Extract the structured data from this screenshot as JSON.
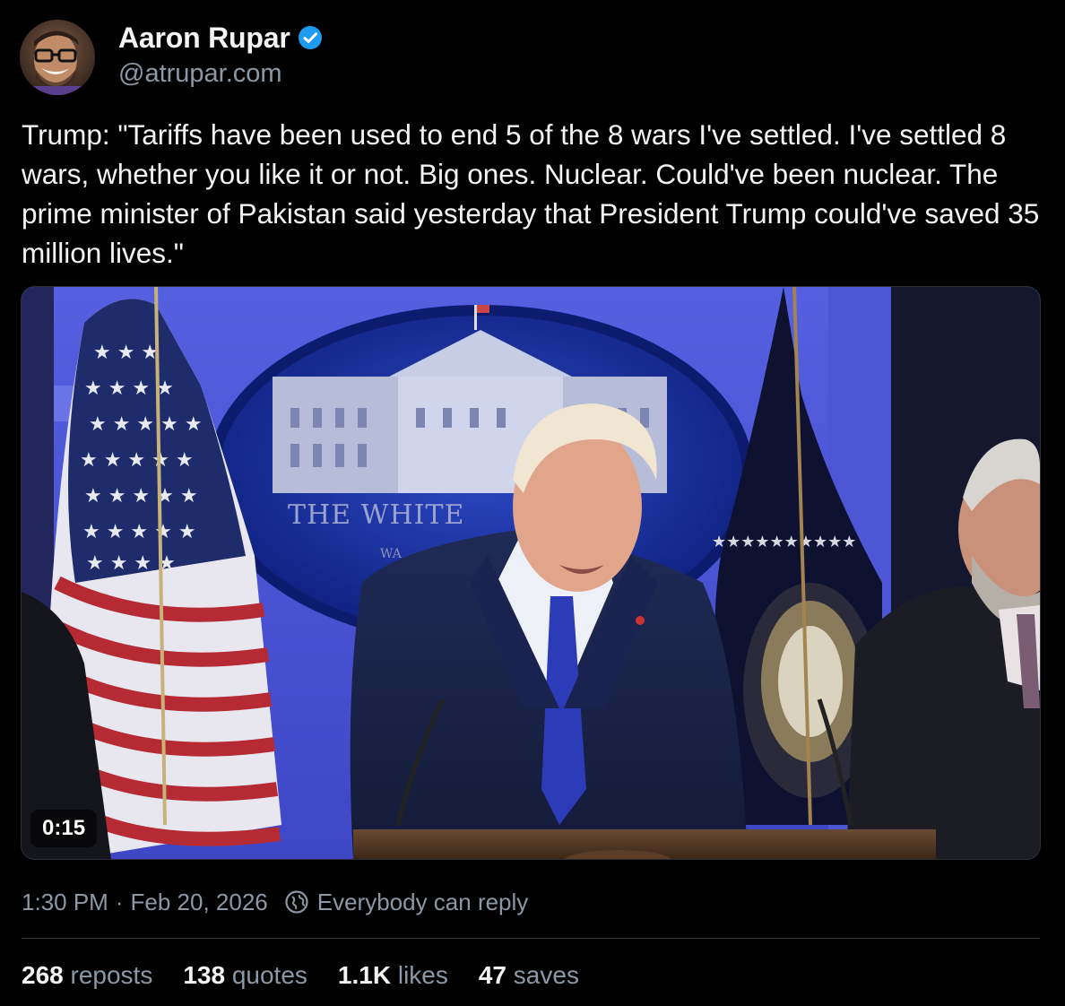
{
  "author": {
    "name": "Aaron Rupar",
    "handle": "@atrupar.com",
    "verified": true,
    "avatar_icon": "avatar-photo"
  },
  "post": {
    "text": "Trump: \"Tariffs have been used to end 5 of the 8 wars I've settled. I've settled 8 wars, whether you like it or not. Big ones. Nuclear. Could've been nuclear. The prime minister of Pakistan said yesterday that President Trump could've saved 35 million lives.\""
  },
  "video": {
    "duration": "0:15",
    "backdrop_text": "THE WHITE",
    "backdrop_text_small": "WA"
  },
  "meta": {
    "time": "1:30 PM",
    "separator": "·",
    "date": "Feb 20, 2026",
    "reply_setting": "Everybody can reply"
  },
  "stats": [
    {
      "count": "268",
      "label": "reposts"
    },
    {
      "count": "138",
      "label": "quotes"
    },
    {
      "count": "1.1K",
      "label": "likes"
    },
    {
      "count": "47",
      "label": "saves"
    }
  ],
  "colors": {
    "background": "#000000",
    "text_primary": "#f1f3f5",
    "text_secondary": "#8b98a5",
    "verified": "#1d9bf0",
    "divider": "#2f3336"
  }
}
